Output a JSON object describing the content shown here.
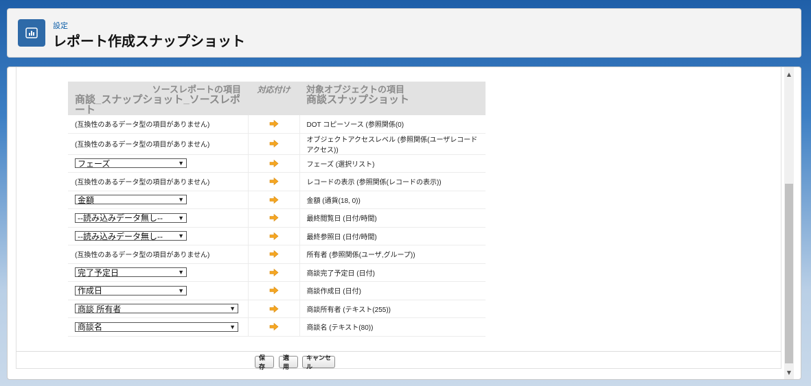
{
  "header": {
    "eyebrow": "設定",
    "title": "レポート作成スナップショット",
    "icon": "report-icon"
  },
  "table": {
    "headers": {
      "source_line1": "ソースレポートの項目",
      "source_line2": "商談_スナップショット_ソースレポート",
      "mapping": "対応付け",
      "target_line1": "対象オブジェクトの項目",
      "target_line2": "商談スナップショット"
    },
    "rows": [
      {
        "source_type": "text",
        "source": "(互換性のあるデータ型の項目がありません)",
        "target": "DOT コピーソース (参照関係(0)"
      },
      {
        "source_type": "text",
        "source": "(互換性のあるデータ型の項目がありません)",
        "target": "オブジェクトアクセスレベル (参照関係(ユーザレコードアクセス))"
      },
      {
        "source_type": "select",
        "source": "フェーズ",
        "target": "フェーズ (選択リスト)"
      },
      {
        "source_type": "text",
        "source": "(互換性のあるデータ型の項目がありません)",
        "target": "レコードの表示 (参照関係(レコードの表示))"
      },
      {
        "source_type": "select",
        "source": "金額",
        "target": "金額 (通貨(18, 0))"
      },
      {
        "source_type": "select",
        "source": "--読み込みデータ無し--",
        "target": "最終閲覧日 (日付/時間)"
      },
      {
        "source_type": "select",
        "source": "--読み込みデータ無し--",
        "target": "最終参照日 (日付/時間)"
      },
      {
        "source_type": "text",
        "source": "(互換性のあるデータ型の項目がありません)",
        "target": "所有者 (参照関係(ユーザ,グループ))"
      },
      {
        "source_type": "select",
        "source": "完了予定日",
        "target": "商談完了予定日 (日付)"
      },
      {
        "source_type": "select",
        "source": "作成日",
        "target": "商談作成日 (日付)"
      },
      {
        "source_type": "select_wide",
        "source": "商談 所有者",
        "target": "商談所有者 (テキスト(255))"
      },
      {
        "source_type": "select_wide",
        "source": "商談名",
        "target": "商談名 (テキスト(80))"
      }
    ]
  },
  "buttons": {
    "save": "保存",
    "apply": "適用",
    "cancel": "キャンセル"
  },
  "colors": {
    "header_icon_bg": "#2e6aa8",
    "arrow": "#f5a623"
  }
}
